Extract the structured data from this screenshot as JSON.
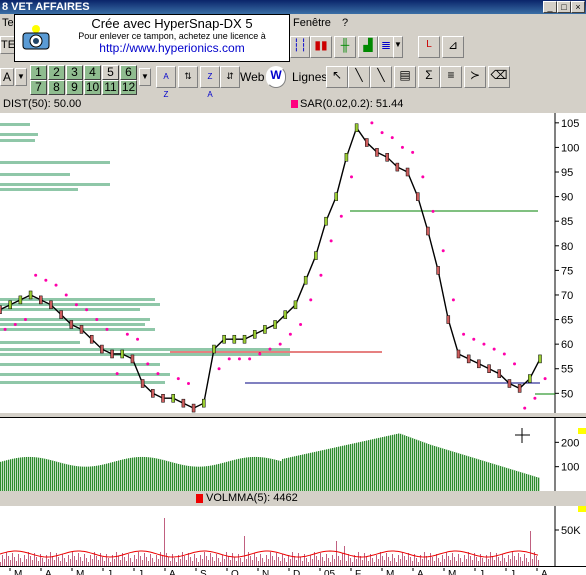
{
  "window": {
    "title": "8  VET AFFAIRES"
  },
  "menu": {
    "items_left": "Te",
    "item_window": "Fenêtre",
    "item_help": "?"
  },
  "watermark": {
    "line1": "Crée avec HyperSnap-DX 5",
    "line2": "Pour enlever ce tampon, achetez une licence à",
    "line3": "http://www.hyperionics.com"
  },
  "toolbar": {
    "left_label_top": "TE",
    "left_label": "A",
    "number_buttons_row1": [
      "1",
      "2",
      "3",
      "4",
      "5",
      "6"
    ],
    "number_buttons_row2": [
      "7",
      "8",
      "9",
      "10",
      "11",
      "12"
    ],
    "web_label": "Web",
    "lines_label": "Lignes"
  },
  "price_panel": {
    "dist_label": "DIST(50): 50.00",
    "sar_label": "SAR(0.02,0.2): 51.44",
    "y_ticks": [
      "105",
      "100",
      "95",
      "90",
      "85",
      "80",
      "75",
      "70",
      "65",
      "60",
      "55",
      "50"
    ]
  },
  "volume_panel": {
    "y_ticks": [
      "200",
      "100"
    ]
  },
  "volmma_panel": {
    "label": "VOLMMA(5):  4462",
    "y_ticks": [
      "50K"
    ]
  },
  "x_axis": {
    "labels": [
      "M",
      "A",
      "M",
      "J",
      "J",
      "A",
      "S",
      "O",
      "N",
      "D",
      "05",
      "F",
      "M",
      "A",
      "M",
      "J",
      "J",
      "A"
    ]
  },
  "colors": {
    "sar": "#ff00aa",
    "volume": "#2e8b2e",
    "green_line": "#008000",
    "red_line": "#cc0000",
    "blue_line": "#000080"
  },
  "chart_data": {
    "type": "line",
    "title": "",
    "series": [
      {
        "name": "SAR(0.02,0.2)",
        "values": []
      }
    ],
    "close": [
      67,
      68,
      69,
      70,
      69,
      68,
      66,
      64,
      63,
      61,
      59,
      58,
      58,
      57,
      52,
      50,
      49,
      49,
      48,
      47,
      48,
      59,
      61,
      61,
      61,
      62,
      63,
      64,
      66,
      68,
      73,
      78,
      85,
      90,
      98,
      104,
      101,
      99,
      98,
      96,
      95,
      90,
      83,
      75,
      65,
      58,
      57,
      56,
      55,
      54,
      52,
      51,
      53,
      57
    ],
    "ylim": [
      46,
      107
    ]
  }
}
